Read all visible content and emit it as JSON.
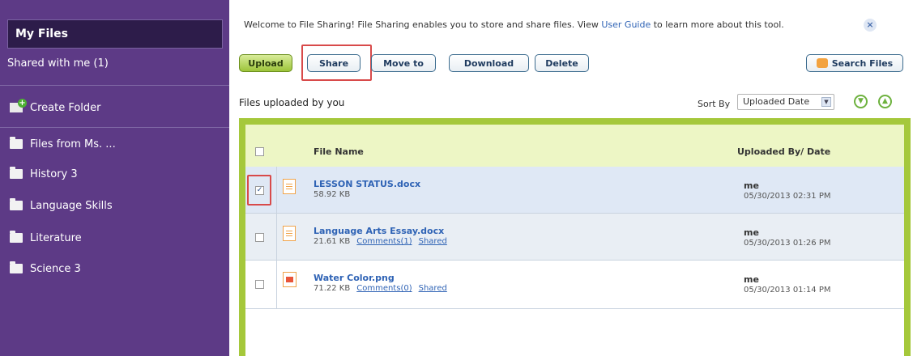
{
  "sidebar": {
    "my_files": "My Files",
    "shared_with_me": "Shared with me (1)",
    "create_folder": "Create Folder",
    "folders": [
      {
        "label": "Files from Ms. ..."
      },
      {
        "label": "History 3"
      },
      {
        "label": "Language Skills"
      },
      {
        "label": "Literature"
      },
      {
        "label": "Science 3"
      }
    ]
  },
  "banner": {
    "text_before": "Welcome to File Sharing! File Sharing enables you to store and share files. View ",
    "link": "User Guide",
    "text_after": " to learn more about this tool.",
    "close": "×"
  },
  "toolbar": {
    "upload": "Upload",
    "share": "Share",
    "move_to": "Move to",
    "download": "Download",
    "delete": "Delete",
    "search_files": "Search Files"
  },
  "list": {
    "heading": "Files uploaded by you",
    "sort_label": "Sort By",
    "sort_value": "Uploaded Date",
    "columns": {
      "name": "File Name",
      "uploaded": "Uploaded By/ Date"
    },
    "files": [
      {
        "name": "LESSON STATUS.docx",
        "size": "58.92 KB",
        "comments": "",
        "shared": "",
        "by": "me",
        "date": "05/30/2013 02:31 PM",
        "checked": "✓"
      },
      {
        "name": "Language Arts Essay.docx",
        "size": "21.61 KB",
        "comments": "Comments(1)",
        "shared": "Shared",
        "by": "me",
        "date": "05/30/2013 01:26 PM",
        "checked": ""
      },
      {
        "name": "Water Color.png",
        "size": "71.22 KB",
        "comments": "Comments(0)",
        "shared": "Shared",
        "by": "me",
        "date": "05/30/2013 01:14 PM",
        "checked": ""
      }
    ]
  },
  "colors": {
    "sidebar_bg": "#5d3a86",
    "frame_green": "#a5c83b",
    "highlight_red": "#d84a4a",
    "link_blue": "#2f63b5"
  }
}
